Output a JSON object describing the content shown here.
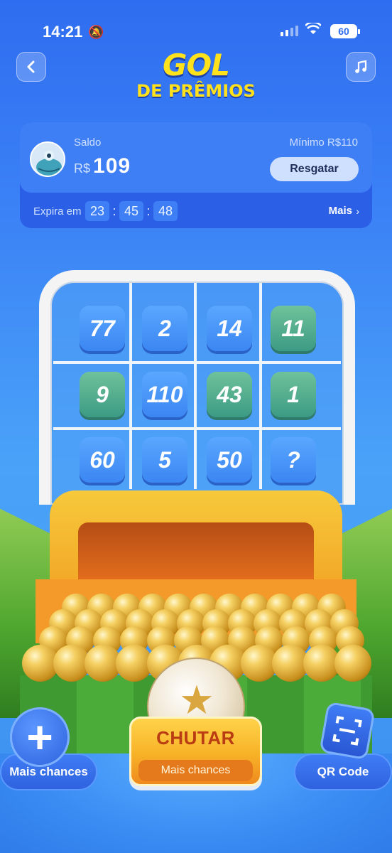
{
  "status_bar": {
    "time": "14:21",
    "battery": "60"
  },
  "header": {
    "title_line1": "GOL",
    "title_line2": "DE PRÊMIOS"
  },
  "balance_card": {
    "saldo_label": "Saldo",
    "currency": "R$",
    "amount": "109",
    "minimo_label": "Mínimo  R$110",
    "resgatar_label": "Resgatar",
    "expira_label": "Expira em",
    "timer": {
      "hours": "23",
      "minutes": "45",
      "seconds": "48"
    },
    "mais_label": "Mais"
  },
  "grid": {
    "tiles": [
      {
        "value": "77",
        "color": "blue"
      },
      {
        "value": "2",
        "color": "blue"
      },
      {
        "value": "14",
        "color": "blue"
      },
      {
        "value": "11",
        "color": "green"
      },
      {
        "value": "9",
        "color": "green"
      },
      {
        "value": "110",
        "color": "blue"
      },
      {
        "value": "43",
        "color": "green"
      },
      {
        "value": "1",
        "color": "green"
      },
      {
        "value": "60",
        "color": "blue"
      },
      {
        "value": "5",
        "color": "blue"
      },
      {
        "value": "50",
        "color": "blue"
      },
      {
        "value": "?",
        "color": "blue"
      }
    ]
  },
  "bottom": {
    "mais_chances_label": "Mais chances",
    "chutar_label": "CHUTAR",
    "chutar_sub": "Mais chances",
    "qr_label": "QR Code"
  },
  "colors": {
    "accent_yellow": "#ffe21c",
    "primary_blue": "#3f7ff6",
    "tile_green": "#3c9b84"
  }
}
